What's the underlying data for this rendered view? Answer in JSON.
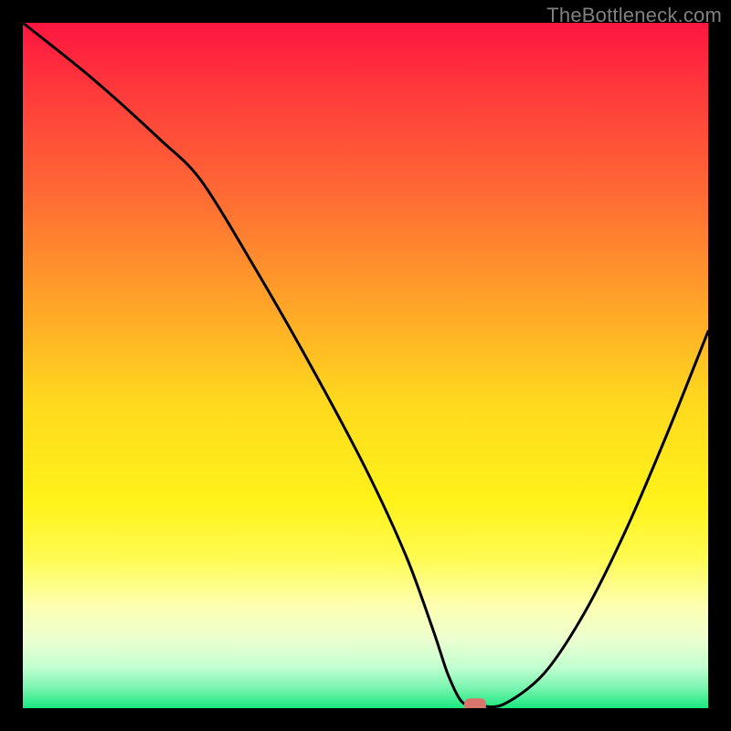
{
  "watermark": "TheBottleneck.com",
  "chart_data": {
    "type": "line",
    "title": "",
    "xlabel": "",
    "ylabel": "",
    "xlim": [
      0,
      100
    ],
    "ylim": [
      0,
      100
    ],
    "x": [
      0,
      10,
      20,
      26,
      34,
      42,
      50,
      56,
      60,
      62,
      64,
      66,
      70,
      76,
      82,
      88,
      94,
      100
    ],
    "values": [
      100,
      92,
      83,
      77,
      64,
      50,
      35,
      22,
      11,
      5,
      1,
      0.5,
      0.5,
      5,
      14,
      26,
      40,
      55
    ],
    "marker": {
      "x": 66,
      "y": 0.5
    },
    "background": {
      "type": "vertical-gradient",
      "stops": [
        {
          "pos": 0.0,
          "color": "#ff1540"
        },
        {
          "pos": 0.1,
          "color": "#ff3a3c"
        },
        {
          "pos": 0.25,
          "color": "#ff6a34"
        },
        {
          "pos": 0.4,
          "color": "#ffa029"
        },
        {
          "pos": 0.55,
          "color": "#ffd81e"
        },
        {
          "pos": 0.7,
          "color": "#fff31a"
        },
        {
          "pos": 0.78,
          "color": "#fffb50"
        },
        {
          "pos": 0.85,
          "color": "#fdffb0"
        },
        {
          "pos": 0.9,
          "color": "#ecffd0"
        },
        {
          "pos": 0.94,
          "color": "#c2ffd0"
        },
        {
          "pos": 0.97,
          "color": "#7bf5b0"
        },
        {
          "pos": 1.0,
          "color": "#19e880"
        }
      ]
    },
    "annotations": []
  }
}
